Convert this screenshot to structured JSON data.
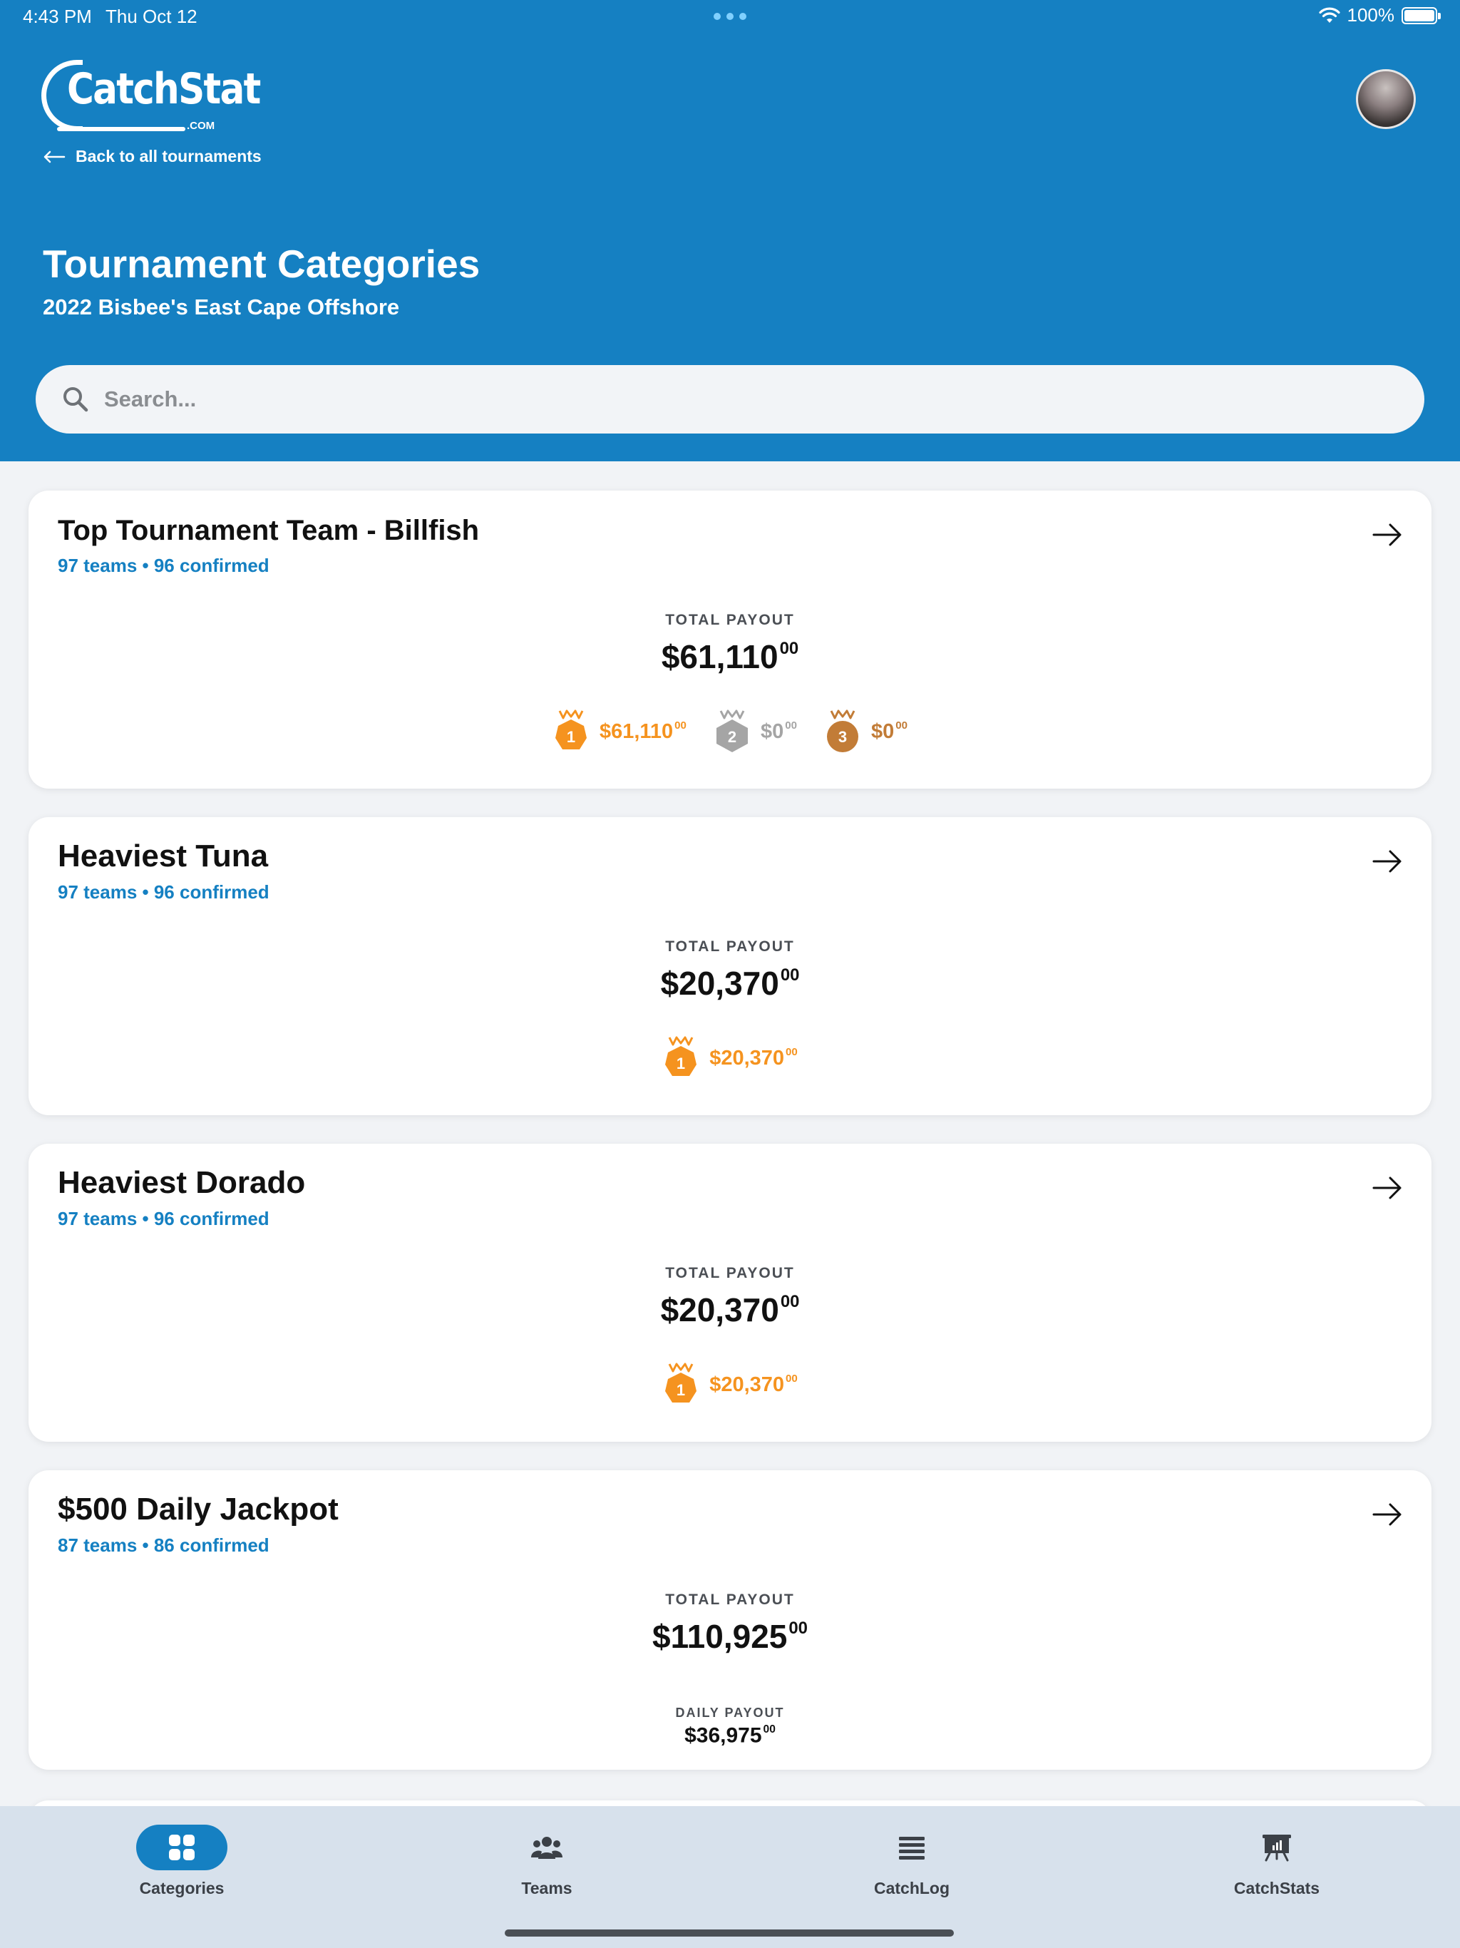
{
  "status_bar": {
    "time": "4:43 PM",
    "date": "Thu Oct 12",
    "battery": "100%"
  },
  "header": {
    "logo_text": "CatchStat",
    "logo_domain": ".COM",
    "back_label": "Back to all tournaments",
    "title": "Tournament Categories",
    "subtitle": "2022 Bisbee's East Cape Offshore"
  },
  "search": {
    "placeholder": "Search..."
  },
  "categories": [
    {
      "name": "Top Tournament Team - Billfish",
      "meta": "97 teams • 96 confirmed",
      "payout_label": "TOTAL PAYOUT",
      "payout_main": "$61,110",
      "payout_cents": "00",
      "prizes": [
        {
          "place": "1",
          "amount": "$61,110",
          "cents": "00"
        },
        {
          "place": "2",
          "amount": "$0",
          "cents": "00"
        },
        {
          "place": "3",
          "amount": "$0",
          "cents": "00"
        }
      ]
    },
    {
      "name": "Heaviest Tuna",
      "meta": "97 teams • 96 confirmed",
      "payout_label": "TOTAL PAYOUT",
      "payout_main": "$20,370",
      "payout_cents": "00",
      "prizes": [
        {
          "place": "1",
          "amount": "$20,370",
          "cents": "00"
        }
      ]
    },
    {
      "name": "Heaviest Dorado",
      "meta": "97 teams • 96 confirmed",
      "payout_label": "TOTAL PAYOUT",
      "payout_main": "$20,370",
      "payout_cents": "00",
      "prizes": [
        {
          "place": "1",
          "amount": "$20,370",
          "cents": "00"
        }
      ]
    },
    {
      "name": "$500 Daily Jackpot",
      "meta": "87 teams • 86 confirmed",
      "payout_label": "TOTAL PAYOUT",
      "payout_main": "$110,925",
      "payout_cents": "00",
      "daily_label": "DAILY PAYOUT",
      "daily_main": "$36,975",
      "daily_cents": "00"
    }
  ],
  "tabs": [
    {
      "label": "Categories",
      "icon": "grid-icon",
      "active": true
    },
    {
      "label": "Teams",
      "icon": "people-icon",
      "active": false
    },
    {
      "label": "CatchLog",
      "icon": "list-icon",
      "active": false
    },
    {
      "label": "CatchStats",
      "icon": "chart-board-icon",
      "active": false
    }
  ],
  "colors": {
    "brand_blue": "#1580c2",
    "gold": "#f5931f",
    "silver": "#a5a5a5",
    "bronze": "#c27c37",
    "tabbar_bg": "#d7e1ec"
  }
}
